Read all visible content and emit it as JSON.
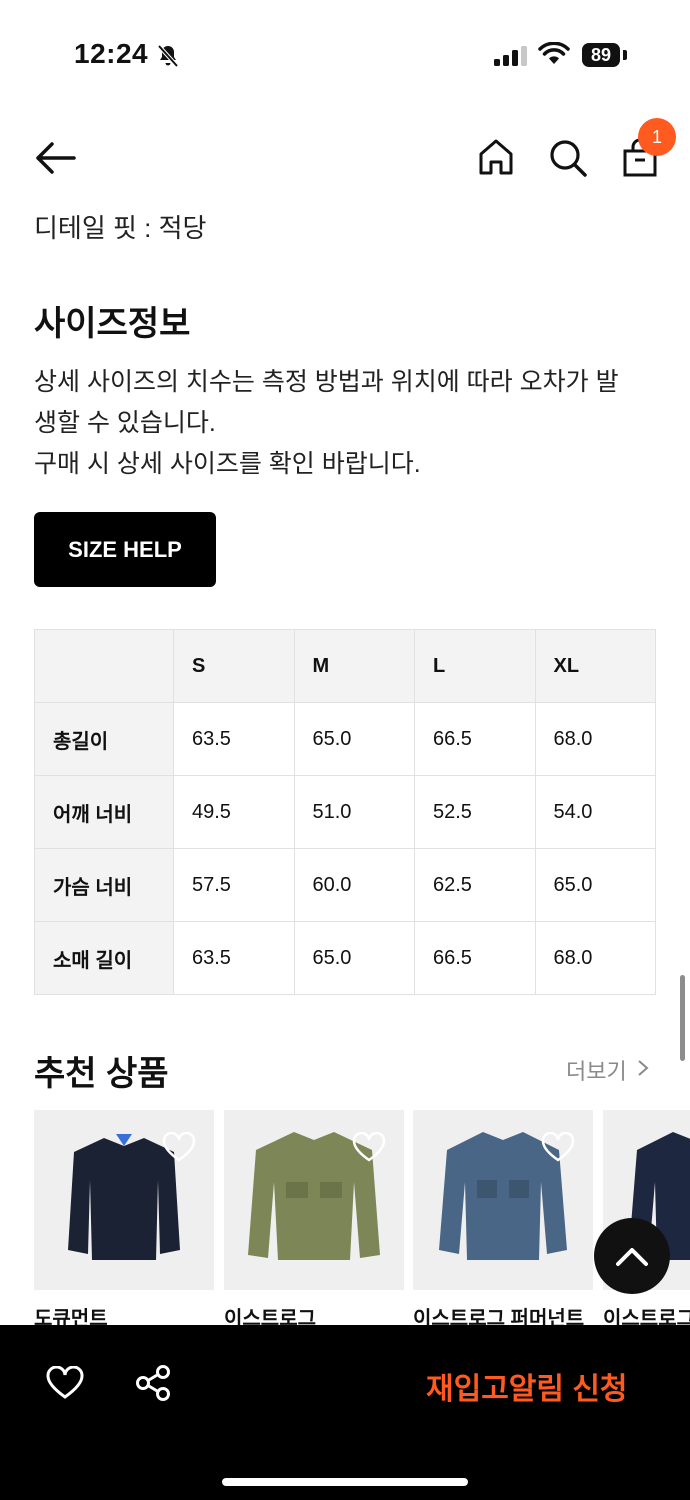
{
  "status_bar": {
    "time": "12:24",
    "battery": "89"
  },
  "detail_fit": "디테일 핏 : 적당",
  "cart_badge": "1",
  "size_info": {
    "title": "사이즈정보",
    "desc_line1": "상세 사이즈의 치수는 측정 방법과 위치에 따라 오차가 발",
    "desc_line2": "생할 수 있습니다.",
    "desc_line3": "구매 시 상세 사이즈를 확인 바랍니다.",
    "help_button": "SIZE HELP"
  },
  "size_table": {
    "headers": [
      "S",
      "M",
      "L",
      "XL"
    ],
    "rows": [
      {
        "label": "총길이",
        "values": [
          "63.5",
          "65.0",
          "66.5",
          "68.0"
        ]
      },
      {
        "label": "어깨 너비",
        "values": [
          "49.5",
          "51.0",
          "52.5",
          "54.0"
        ]
      },
      {
        "label": "가슴 너비",
        "values": [
          "57.5",
          "60.0",
          "62.5",
          "65.0"
        ]
      },
      {
        "label": "소매 길이",
        "values": [
          "63.5",
          "65.0",
          "66.5",
          "68.0"
        ]
      }
    ]
  },
  "recommend": {
    "title": "추천 상품",
    "more": "더보기",
    "products": [
      {
        "name": "도큐먼트",
        "color": "#1a2233"
      },
      {
        "name": "이스트로그",
        "color": "#7d8656"
      },
      {
        "name": "이스트로그 퍼머넌트",
        "color": "#4a6686"
      },
      {
        "name": "이스트로그",
        "color": "#1d2740"
      }
    ]
  },
  "bottom_bar": {
    "restock_label": "재입고알림 신청"
  },
  "colors": {
    "accent": "#ff5a1f",
    "bar": "#000000"
  }
}
